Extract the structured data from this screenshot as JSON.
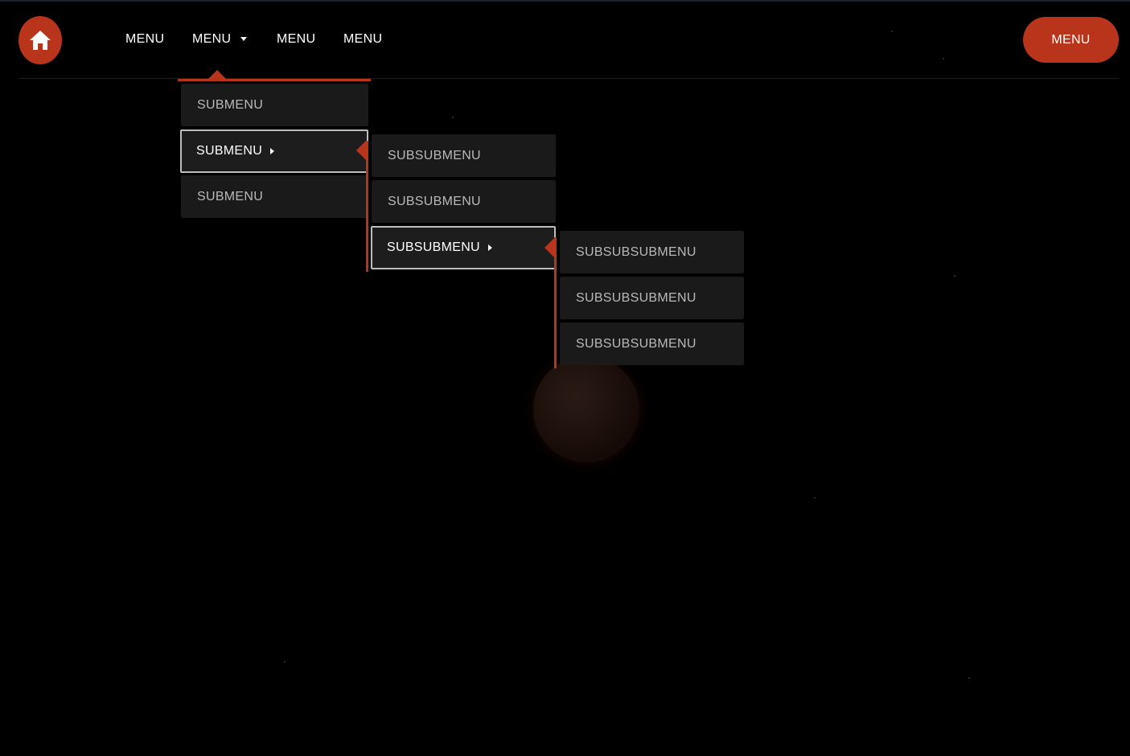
{
  "nav": {
    "home_icon": "home-icon",
    "items": [
      {
        "label": "MENU"
      },
      {
        "label": "MENU",
        "has_dropdown": true
      },
      {
        "label": "MENU"
      },
      {
        "label": "MENU"
      }
    ],
    "cta_label": "MENU"
  },
  "submenu": {
    "items": [
      {
        "label": "SUBMENU"
      },
      {
        "label": "SUBMENU",
        "active": true
      },
      {
        "label": "SUBMENU"
      }
    ]
  },
  "subsubmenu": {
    "items": [
      {
        "label": "SUBSUBMENU"
      },
      {
        "label": "SUBSUBMENU"
      },
      {
        "label": "SUBSUBMENU",
        "active": true
      }
    ]
  },
  "subsubsubmenu": {
    "items": [
      {
        "label": "SUBSUBSUBMENU"
      },
      {
        "label": "SUBSUBSUBMENU"
      },
      {
        "label": "SUBSUBSUBMENU"
      }
    ]
  },
  "colors": {
    "accent": "#b8351c",
    "background": "#000000",
    "menu_item_bg": "#1a1a1a",
    "text": "#ffffff",
    "muted_text": "#b9b9b9"
  }
}
